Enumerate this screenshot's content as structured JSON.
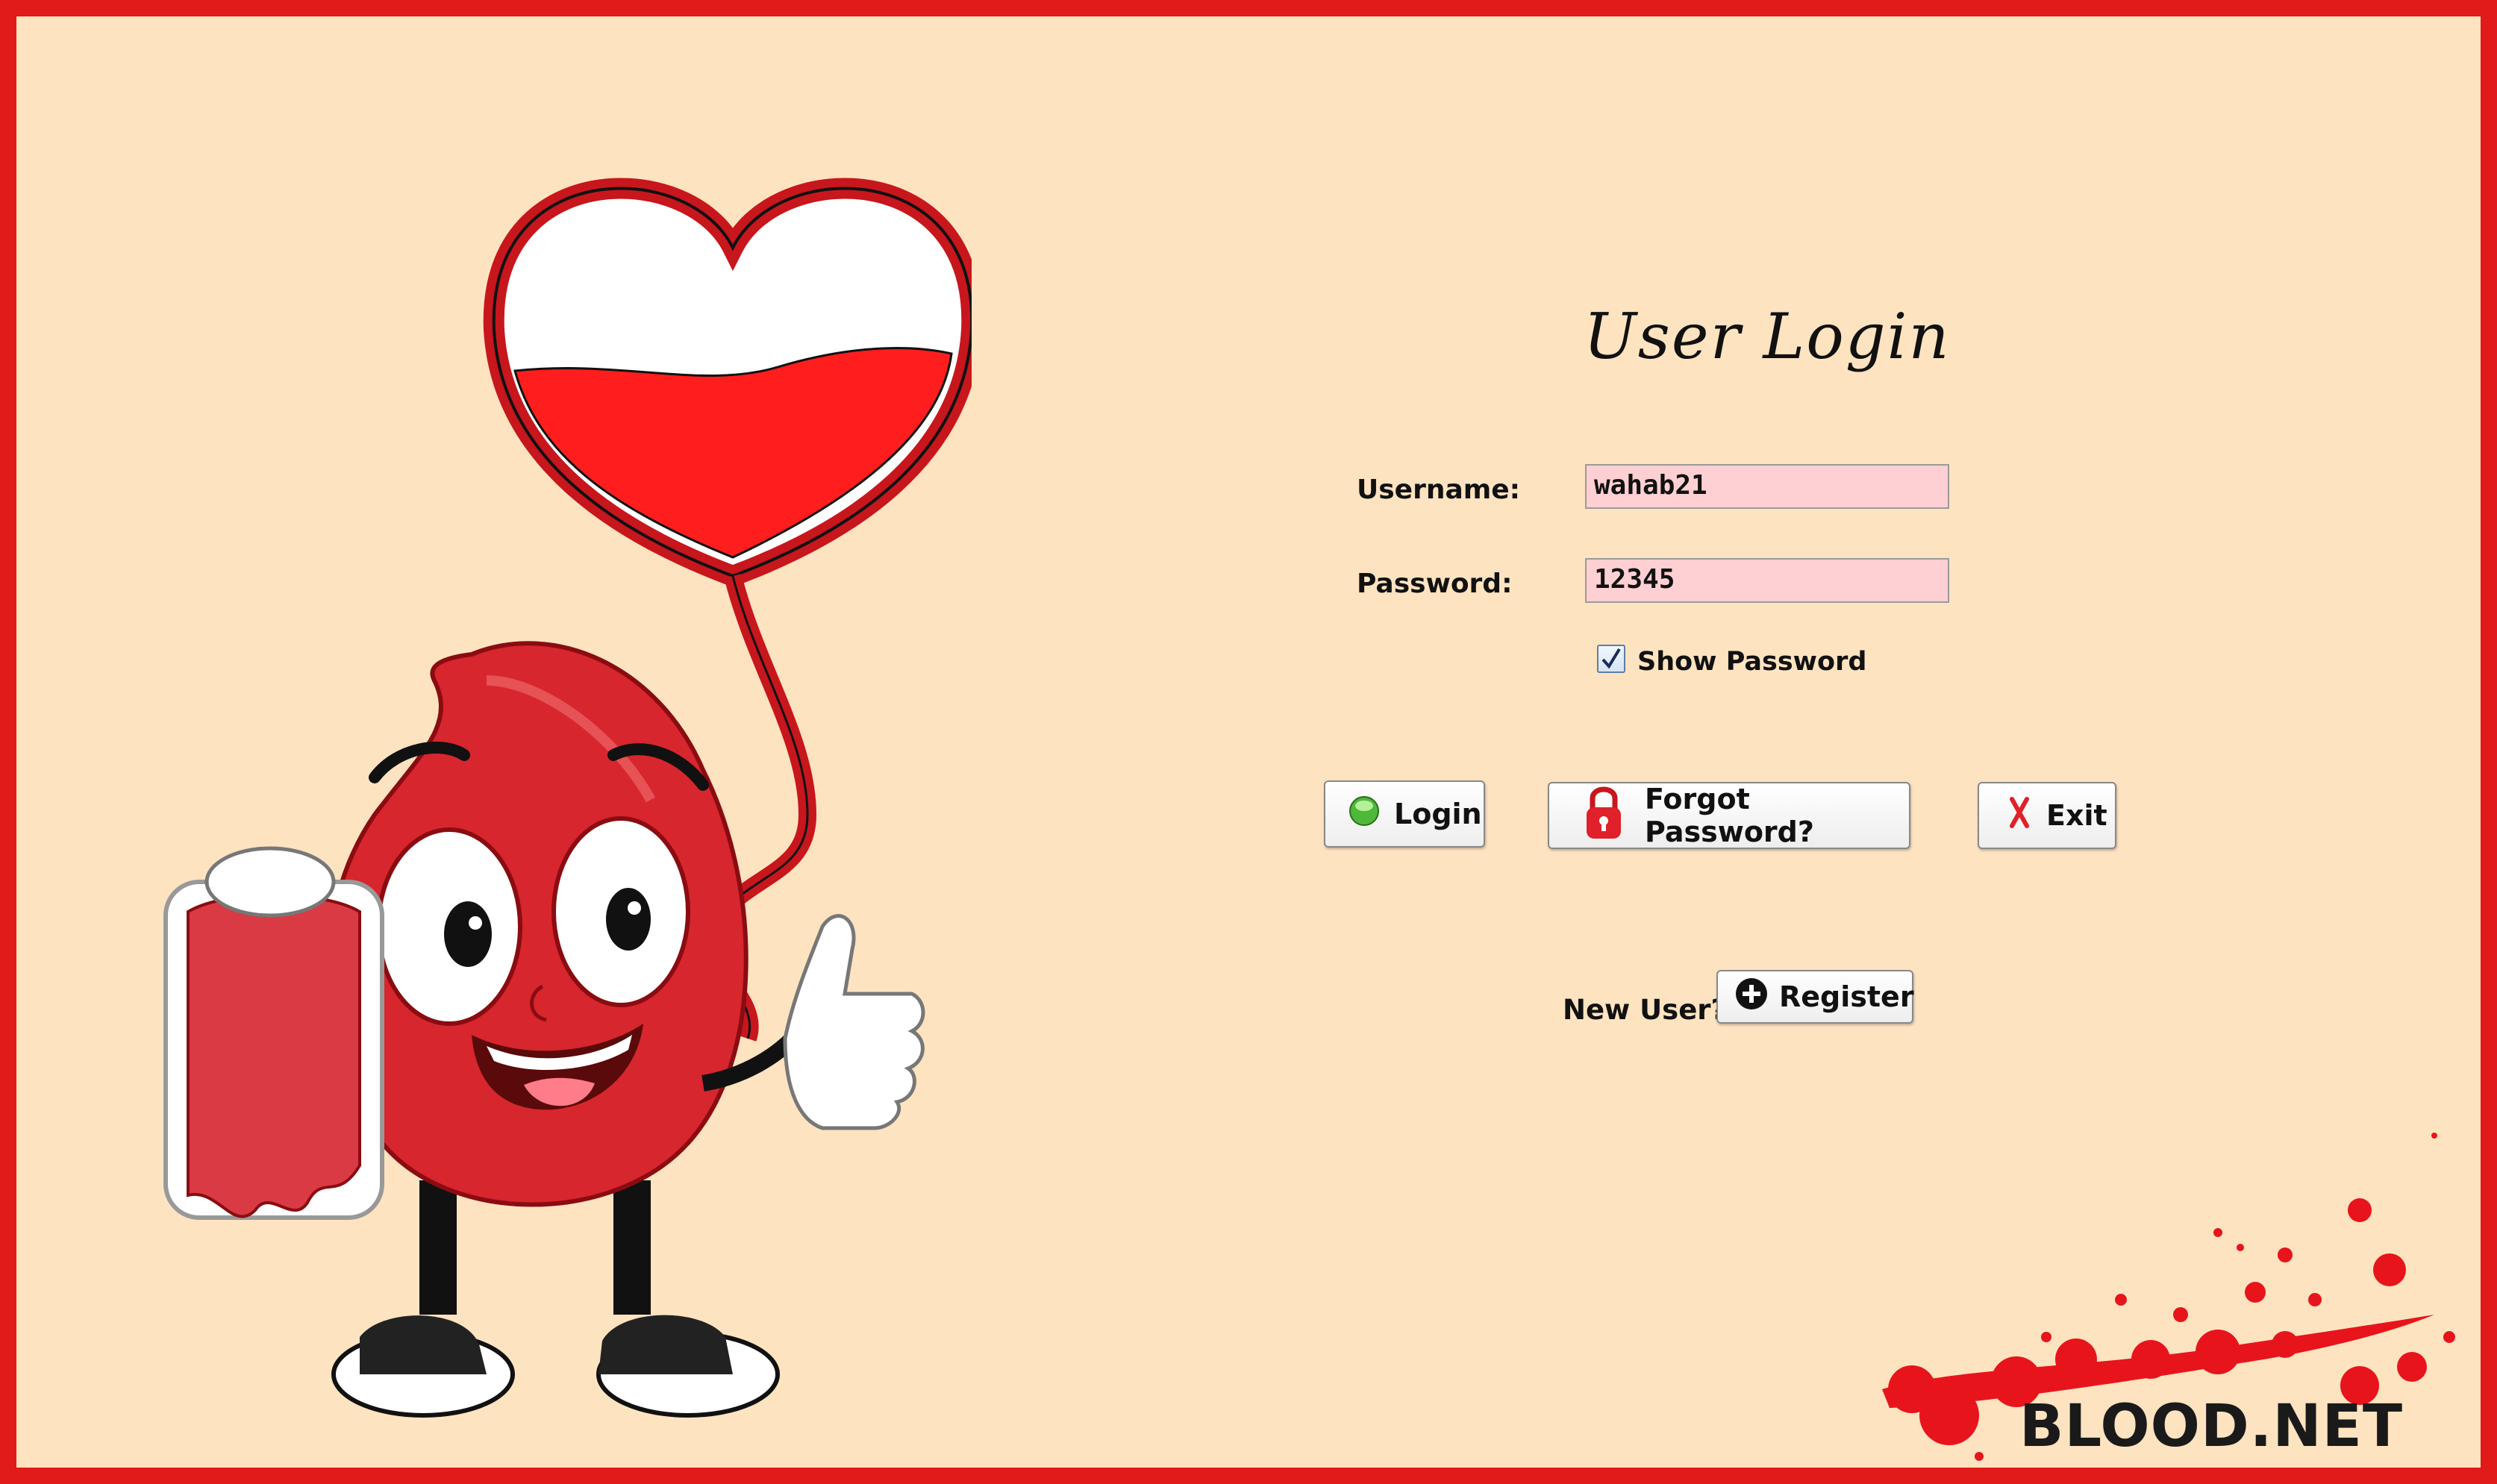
{
  "login": {
    "title": "User Login",
    "username_label": "Username:",
    "username_value": "wahab21",
    "password_label": "Password:",
    "password_value": "12345",
    "show_password_label": "Show Password",
    "show_password_checked": true,
    "login_button": "Login",
    "forgot_button": "Forgot Password?",
    "exit_button": "Exit",
    "new_user_label": "New User?",
    "register_button": "Register"
  },
  "brand": {
    "name": "BLOOD.NET"
  },
  "icons": {
    "login": "green-orb-icon",
    "forgot": "padlock-icon",
    "exit": "x-icon",
    "register": "plus-circle-icon"
  },
  "colors": {
    "frame_red": "#e11a1a",
    "background": "#fee3c0",
    "field_pink": "#ffd0d3",
    "blood_red": "#d7262d"
  }
}
